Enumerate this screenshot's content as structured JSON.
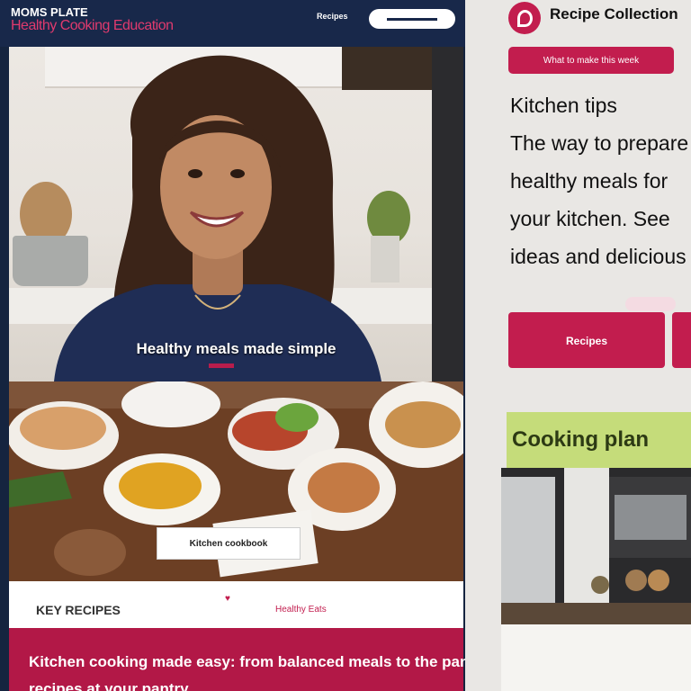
{
  "header": {
    "brand": "MOMS PLATE",
    "brand_sub": "Healthy Cooking Education",
    "nav_link": "Recipes"
  },
  "hero": {
    "caption": "Healthy meals made simple"
  },
  "food": {
    "tag": "Kitchen cookbook"
  },
  "footer": {
    "left": "KEY RECIPES",
    "right": "Healthy Eats"
  },
  "promo": {
    "line1": "Kitchen cooking made easy: from balanced meals to the pantry",
    "line2": "recipes at your pantry"
  },
  "sidebar": {
    "site_title": "Recipe Collection",
    "pill_label": "What to make this week",
    "intro_lines": [
      "Kitchen tips",
      "The way to prepare",
      "healthy meals for",
      "your kitchen. See",
      "ideas and delicious"
    ],
    "cta_label": "Recipes",
    "section_title": "Cooking plan"
  },
  "colors": {
    "accent": "#c21d4e",
    "navy": "#18284a",
    "green": "#c5dc7a"
  }
}
